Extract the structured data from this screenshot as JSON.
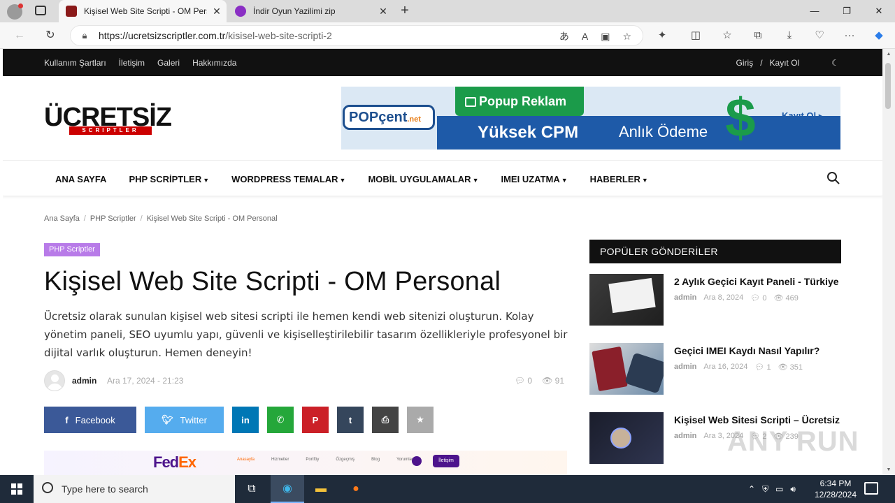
{
  "browser": {
    "tabs": [
      {
        "title": "Kişisel Web Site Scripti - OM Pers",
        "active": true
      },
      {
        "title": "İndir Oyun Yazilimi zip",
        "active": false
      }
    ],
    "url_host": "https://ucretsizscriptler.com.tr",
    "url_path": "/kisisel-web-site-scripti-2"
  },
  "site": {
    "topbar_links": [
      "Kullanım Şartları",
      "İletişim",
      "Galeri",
      "Hakkımızda"
    ],
    "login": "Giriş",
    "register": "Kayıt Ol",
    "logo_text": "ÜCRETSİZ",
    "logo_sub": "SCRIPTLER",
    "banner": {
      "brand": "POPçent",
      "brand_suffix": ".net",
      "popup": "Popup Reklam",
      "cpm": "Yüksek CPM",
      "payment": "Anlık Ödeme",
      "cta": "Kayıt Ol"
    },
    "nav": [
      {
        "label": "ANA SAYFA",
        "dropdown": false
      },
      {
        "label": "PHP SCRİPTLER",
        "dropdown": true
      },
      {
        "label": "WORDPRESS TEMALAR",
        "dropdown": true
      },
      {
        "label": "MOBİL UYGULAMALAR",
        "dropdown": true
      },
      {
        "label": "IMEI UZATMA",
        "dropdown": true
      },
      {
        "label": "HABERLER",
        "dropdown": true
      }
    ]
  },
  "breadcrumb": [
    "Ana Sayfa",
    "PHP Scriptler",
    "Kişisel Web Site Scripti - OM Personal"
  ],
  "post": {
    "category": "PHP Scriptler",
    "title": "Kişisel Web Site Scripti - OM Personal",
    "excerpt": "Ücretsiz olarak sunulan kişisel web sitesi scripti ile hemen kendi web sitenizi oluşturun. Kolay yönetim paneli, SEO uyumlu yapı, güvenli ve kişiselleştirilebilir tasarım özellikleriyle profesyonel bir dijital varlık oluşturun. Hemen deneyin!",
    "author": "admin",
    "date": "Ara 17, 2024 - 21:23",
    "comments": "0",
    "views": "91",
    "share": {
      "facebook": "Facebook",
      "twitter": "Twitter"
    }
  },
  "fedex_preview": {
    "logo_a": "Fed",
    "logo_b": "Ex",
    "menu": [
      "Anasayfa",
      "Hizmetler",
      "Portföy",
      "Özgeçmiş",
      "Blog",
      "Yorumlarımız"
    ],
    "cta": "İletişim"
  },
  "sidebar": {
    "heading": "POPÜLER GÖNDERİLER",
    "posts": [
      {
        "title": "2 Aylık Geçici Kayıt Paneli - Türkiye",
        "author": "admin",
        "date": "Ara 8, 2024",
        "comments": "0",
        "views": "469"
      },
      {
        "title": "Geçici IMEI Kaydı Nasıl Yapılır?",
        "author": "admin",
        "date": "Ara 16, 2024",
        "comments": "1",
        "views": "351"
      },
      {
        "title": "Kişisel Web Sitesi Scripti – Ücretsiz",
        "author": "admin",
        "date": "Ara 3, 2024",
        "comments": "2",
        "views": "239"
      }
    ]
  },
  "taskbar": {
    "search_placeholder": "Type here to search",
    "time": "6:34 PM",
    "date": "12/28/2024"
  },
  "watermark": "ANY RUN"
}
